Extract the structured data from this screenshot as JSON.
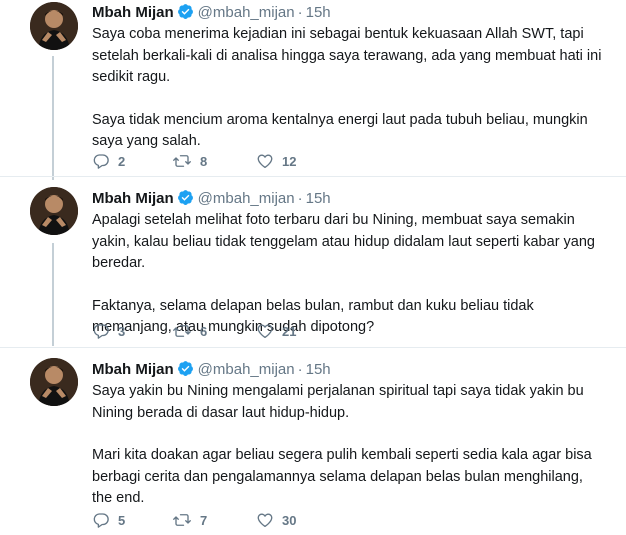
{
  "tweets": [
    {
      "name": "Mbah Mijan",
      "handle": "@mbah_mijan",
      "separator": "·",
      "time": "15h",
      "paragraphs": [
        "Saya coba menerima kejadian ini sebagai bentuk kekuasaan Allah SWT, tapi setelah berkali-kali di analisa hingga saya terawang, ada yang membuat hati ini sedikit ragu.",
        "Saya tidak mencium aroma kentalnya energi laut pada tubuh beliau, mungkin saya yang salah."
      ],
      "replies": "2",
      "retweets": "8",
      "likes": "12"
    },
    {
      "name": "Mbah Mijan",
      "handle": "@mbah_mijan",
      "separator": "·",
      "time": "15h",
      "paragraphs": [
        "Apalagi setelah melihat foto terbaru dari bu Nining, membuat saya semakin yakin, kalau beliau tidak tenggelam atau hidup didalam laut seperti kabar yang beredar.",
        "Faktanya, selama delapan belas bulan, rambut dan kuku beliau tidak memanjang, atau mungkin sudah dipotong?"
      ],
      "replies": "3",
      "retweets": "6",
      "likes": "21"
    },
    {
      "name": "Mbah Mijan",
      "handle": "@mbah_mijan",
      "separator": "·",
      "time": "15h",
      "paragraphs": [
        "Saya yakin bu Nining mengalami perjalanan spiritual tapi saya tidak yakin bu Nining berada di dasar laut hidup-hidup.",
        "Mari kita doakan agar beliau segera pulih kembali seperti sedia kala agar bisa berbagi cerita dan pengalamannya selama delapan belas bulan menghilang, the end."
      ],
      "replies": "5",
      "retweets": "7",
      "likes": "30"
    }
  ],
  "icons": {
    "verified": "verified-badge-icon",
    "reply": "reply-icon",
    "retweet": "retweet-icon",
    "like": "heart-icon"
  },
  "colors": {
    "text": "#14171a",
    "secondary": "#657786",
    "verified": "#1da1f2",
    "thread_line": "#c4cfd6",
    "divider": "#e6ecf0"
  }
}
